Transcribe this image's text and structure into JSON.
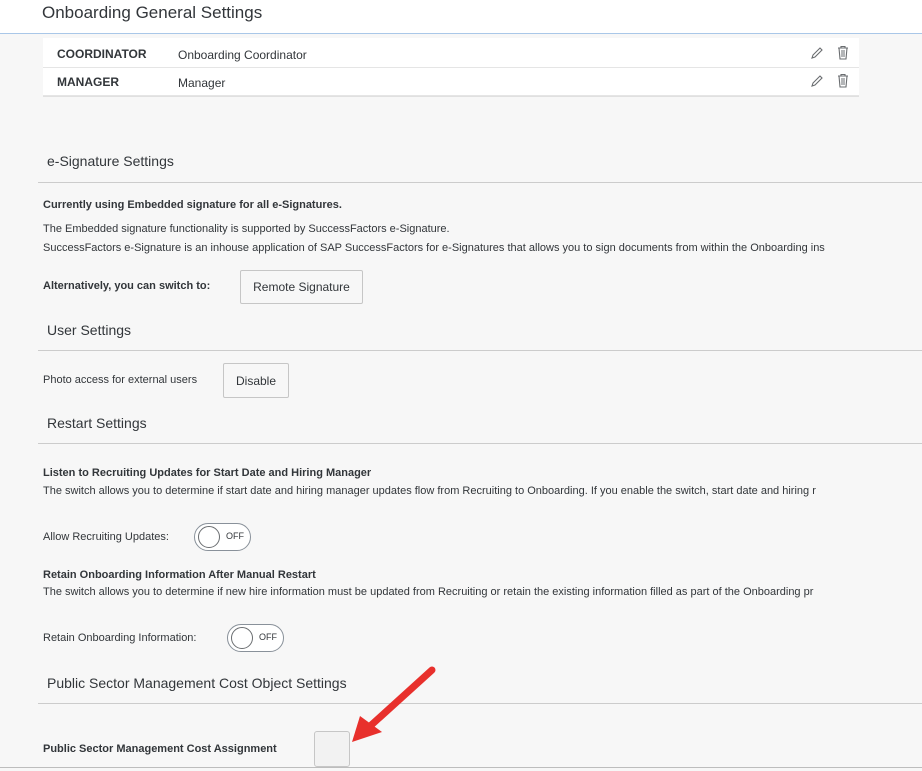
{
  "header": {
    "title": "Onboarding General Settings"
  },
  "roles": [
    {
      "code": "COORDINATOR",
      "name": "Onboarding Coordinator"
    },
    {
      "code": "MANAGER",
      "name": "Manager"
    }
  ],
  "esignature": {
    "title": "e-Signature Settings",
    "current_status": "Currently using Embedded signature for all e-Signatures.",
    "desc_line1": "The Embedded signature functionality is supported by SuccessFactors e-Signature.",
    "desc_line2": "SuccessFactors e-Signature is an inhouse application of SAP SuccessFactors for e-Signatures that allows you to sign documents from within the Onboarding ins",
    "switch_label": "Alternatively, you can switch to:",
    "switch_button": "Remote Signature"
  },
  "user_settings": {
    "title": "User Settings",
    "photo_label": "Photo access for external users",
    "disable_button": "Disable"
  },
  "restart_settings": {
    "title": "Restart Settings",
    "listen_heading": "Listen to Recruiting Updates for Start Date and Hiring Manager",
    "listen_desc": "The switch allows you to determine if start date and hiring manager updates flow from Recruiting to Onboarding. If you enable the switch, start date and hiring r",
    "allow_label": "Allow Recruiting Updates:",
    "allow_state": "OFF",
    "retain_heading": "Retain Onboarding Information After Manual Restart",
    "retain_desc": "The switch allows you to determine if new hire information must be updated from Recruiting or retain the existing information filled as part of the Onboarding pr",
    "retain_label": "Retain Onboarding Information:",
    "retain_state": "OFF"
  },
  "public_sector": {
    "title": "Public Sector Management Cost Object Settings",
    "assignment_label": "Public Sector Management Cost Assignment"
  },
  "colors": {
    "accent_arrow": "#e8302c",
    "header_border": "#a9c7e8"
  }
}
